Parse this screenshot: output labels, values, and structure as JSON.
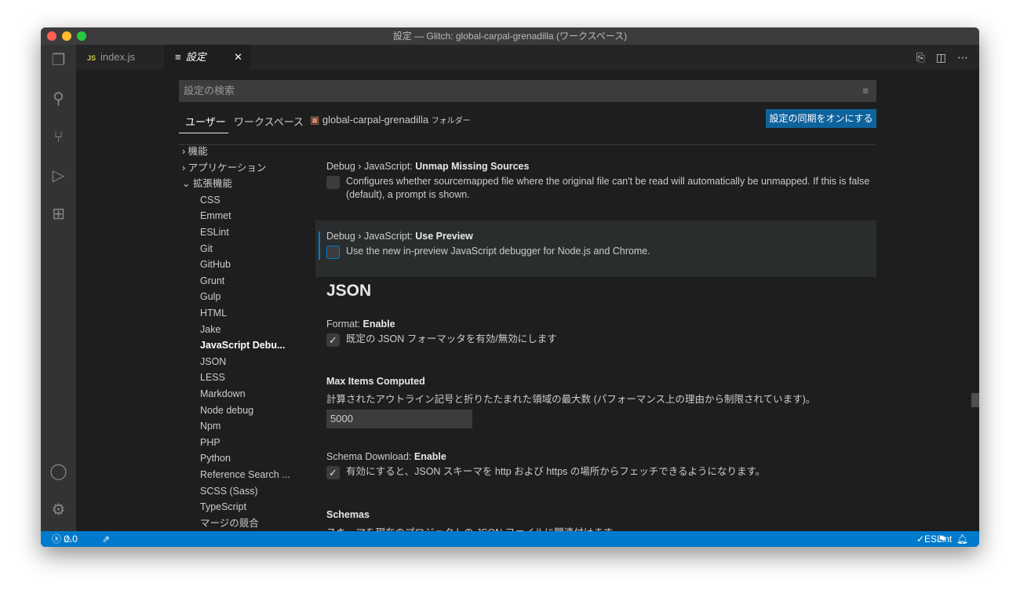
{
  "window": {
    "title": "設定 — Glitch: global-carpal-grenadilla (ワークスペース)"
  },
  "tabs": [
    {
      "icon": "JS",
      "label": "index.js"
    },
    {
      "icon": "≡",
      "label": "設定",
      "close": "✕"
    }
  ],
  "search": {
    "placeholder": "設定の検索"
  },
  "scope_tabs": {
    "user": "ユーザー",
    "workspace": "ワークスペース",
    "folder": "global-carpal-grenadilla",
    "folder_suffix": "フォルダー"
  },
  "sync_button": "設定の同期をオンにする",
  "toc": {
    "groups": [
      "機能",
      "アプリケーション",
      "拡張機能"
    ],
    "items": [
      "CSS",
      "Emmet",
      "ESLint",
      "Git",
      "GitHub",
      "Grunt",
      "Gulp",
      "HTML",
      "Jake",
      "JavaScript Debu...",
      "JSON",
      "LESS",
      "Markdown",
      "Node debug",
      "Npm",
      "PHP",
      "Python",
      "Reference Search ...",
      "SCSS (Sass)",
      "TypeScript",
      "マージの競合"
    ]
  },
  "settings": {
    "unmap": {
      "prefix": "Debug › JavaScript: ",
      "name": "Unmap Missing Sources",
      "desc": "Configures whether sourcemapped file where the original file can't be read will automatically be unmapped. If this is false (default), a prompt is shown.",
      "checked": false
    },
    "preview": {
      "prefix": "Debug › JavaScript: ",
      "name": "Use Preview",
      "desc": "Use the new in-preview JavaScript debugger for Node.js and Chrome.",
      "checked": false
    },
    "section": "JSON",
    "format": {
      "prefix": "Format: ",
      "name": "Enable",
      "desc": "既定の JSON フォーマッタを有効/無効にします",
      "checked": true
    },
    "max": {
      "name": "Max Items Computed",
      "desc": "計算されたアウトライン記号と折りたたまれた領域の最大数 (パフォーマンス上の理由から制限されています)。",
      "value": "5000"
    },
    "schema_dl": {
      "prefix": "Schema Download: ",
      "name": "Enable",
      "desc": "有効にすると、JSON スキーマを http および https の場所からフェッチできるようになります。",
      "checked": true
    },
    "schemas": {
      "name": "Schemas",
      "desc": "スキーマを現在のプロジェクトの JSON ファイルに関連付けます"
    }
  },
  "status": {
    "errors": "0",
    "warnings": "0",
    "eslint": "ESLint"
  },
  "colors": {
    "accent": "#007acc",
    "sync": "#0e639c"
  }
}
